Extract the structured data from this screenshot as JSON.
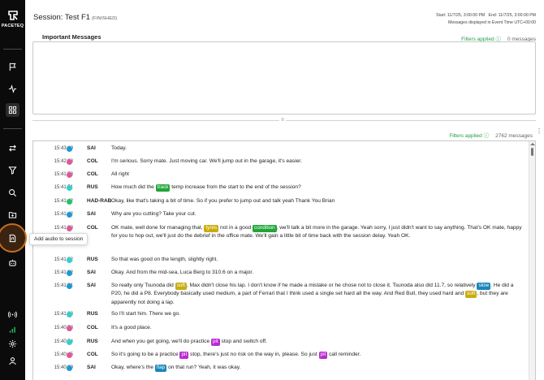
{
  "brand": {
    "name": "PACETEQ"
  },
  "sidebar": {
    "icons": [
      "flag-icon",
      "activity-icon",
      "grid-icon",
      "swap-icon",
      "filter-icon",
      "search-icon",
      "folder-icon",
      "audio-file-icon",
      "robot-icon",
      "broadcast-icon",
      "signal-bars-icon",
      "gear-icon",
      "user-icon"
    ],
    "active": "grid-icon",
    "tooltip": "Add audio to session"
  },
  "header": {
    "title": "Session: Test F1",
    "status": "(FINISHED)",
    "start_end": "Start: 11/7/25, 3:00:00 PM   End: 11/7/25, 3:00:00 PM",
    "timezone_note": "Messages displayed in Event Time UTC+00:00"
  },
  "important": {
    "title": "Important Messages",
    "filters": "Filters applied ⓘ",
    "count": "0 messages"
  },
  "messages_panel": {
    "filters": "Filters applied ⓘ",
    "count": "2762 messages",
    "menu": "⋮"
  },
  "colors": {
    "SAI": "#1d9ad6",
    "COL": "#e0579b",
    "RUS": "#2fd1cf",
    "HAD-RAB": "#22c26a",
    "tag_green": "#21a53a",
    "tag_yellow": "#c9ab10",
    "tag_blue": "#1a86b8",
    "tag_purple": "#b72bcf"
  },
  "messages": [
    {
      "time": "15:43:19",
      "who": "SAI",
      "segments": [
        [
          "Today.",
          null
        ]
      ]
    },
    {
      "time": "15:42:03",
      "who": "COL",
      "segments": [
        [
          "I'm serious. Sorry mate. Just moving car. We'll jump out in the garage, it's easier.",
          null
        ]
      ]
    },
    {
      "time": "15:41:53",
      "who": "COL",
      "segments": [
        [
          "All right",
          null
        ]
      ]
    },
    {
      "time": "15:41:51",
      "who": "RUS",
      "segments": [
        [
          "How much did the ",
          null
        ],
        [
          "track",
          "green"
        ],
        [
          " temp increase from the start to the end of the session?",
          null
        ]
      ]
    },
    {
      "time": "15:41:42",
      "who": "HAD-RAB",
      "segments": [
        [
          "Okay, like that's taking a bit of time. So if you prefer to jump out and talk yeah Thank You Brian",
          null
        ]
      ]
    },
    {
      "time": "15:41:42",
      "who": "SAI",
      "segments": [
        [
          "Why are you cutting? Take your cut.",
          null
        ]
      ]
    },
    {
      "time": "15:41:38",
      "who": "COL",
      "segments": [
        [
          "OK mate, well done for managing that, ",
          null
        ],
        [
          "tyres",
          "yellow"
        ],
        [
          " not in a good ",
          null
        ],
        [
          "condition",
          "green"
        ],
        [
          ", we'll talk a bit more in the garage. Yeah sorry, I just didn't want to say anything. That's OK mate, happy for you to hop out, we'll just do the debrief in the office mate. We'll gain a little bit of time back with the session delay. Yeah OK.",
          null
        ]
      ]
    },
    {
      "time": "15:41:32",
      "who": "RUS",
      "segments": [
        [
          "So that was good on the length, slightly right.",
          null
        ]
      ]
    },
    {
      "time": "15:41:32",
      "who": "SAI",
      "segments": [
        [
          "Okay. And from the mid-sea, Luca Berg to 310.6 on a major.",
          null
        ]
      ]
    },
    {
      "time": "15:41:21",
      "who": "SAI",
      "segments": [
        [
          "So really only Tsunoda did ",
          null
        ],
        [
          "soft",
          "yellow"
        ],
        [
          ", Max didn't close his lap. I don't know if he made a mistake or he chose not to close it. Tsunoda also did 11.7, so relatively ",
          null
        ],
        [
          "slow",
          "blue"
        ],
        [
          ". He did a P20, he did a P8. Everybody basically used medium, a part of Ferrari that I think used a single set hard all the way. And Red Bull, they used hard and ",
          null
        ],
        [
          "soft",
          "yellow"
        ],
        [
          ", but they are apparently not doing a lap.",
          null
        ]
      ]
    },
    {
      "time": "15:41:03",
      "who": "RUS",
      "segments": [
        [
          "So I'll start him. There we go.",
          null
        ]
      ]
    },
    {
      "time": "15:40:58",
      "who": "COL",
      "segments": [
        [
          "It's a good place.",
          null
        ]
      ]
    },
    {
      "time": "15:40:54",
      "who": "RUS",
      "segments": [
        [
          "And when you get going, we'll do practice ",
          null
        ],
        [
          "pit",
          "purple"
        ],
        [
          " stop and switch off.",
          null
        ]
      ]
    },
    {
      "time": "15:40:45",
      "who": "COL",
      "segments": [
        [
          "So it's going to be a practice ",
          null
        ],
        [
          "pit",
          "purple"
        ],
        [
          " stop, there's just no risk on the way in, please. So just ",
          null
        ],
        [
          "pit",
          "purple"
        ],
        [
          " call reminder.",
          null
        ]
      ]
    },
    {
      "time": "15:40:39",
      "who": "SAI",
      "segments": [
        [
          "Okay, where's the ",
          null
        ],
        [
          "flap",
          "blue"
        ],
        [
          " on that run? Yeah, it was okay.",
          null
        ]
      ]
    }
  ]
}
